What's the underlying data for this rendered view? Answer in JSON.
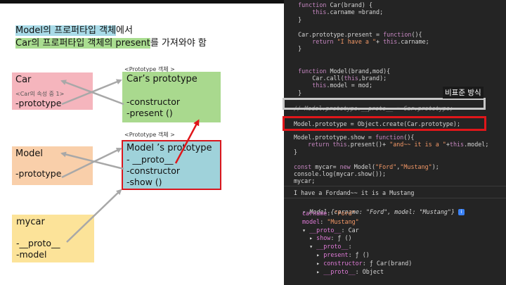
{
  "heading": {
    "line1_hl": "Model의 프로퍼타입 객체",
    "line1_rest": "에서",
    "line2_hl": "Car의 프로퍼타입 객체의 present",
    "line2_rest": "를 가져와야 함"
  },
  "diagram": {
    "car": {
      "title": "Car",
      "note": "<Car의 속성 중 1>",
      "prop": "-prototype"
    },
    "car_proto": {
      "caption": "<Prototype 객체 >",
      "title": "Car’s prototype",
      "lines": [
        "-constructor",
        "-present ()"
      ]
    },
    "model": {
      "title": "Model",
      "prop": "-prototype"
    },
    "model_proto": {
      "caption": "<Prototype 객체 >",
      "title": "Model ’s prototype",
      "lines": [
        "- __proto__",
        "-constructor",
        "-show ()"
      ]
    },
    "mycar": {
      "title": "mycar",
      "lines": [
        "-__proto__",
        "-model"
      ]
    }
  },
  "console": {
    "nonstandard_label": "비표준 방식",
    "code_lines": [
      "  function Car(brand) {",
      "      this.carname =brand;",
      "  }",
      "",
      "  Car.prototype.present = function(){",
      "      return \"I have a \"+ this.carname;",
      "  }",
      "",
      "",
      "  function Model(brand,mod){",
      "      Car.call(this,brand);",
      "      this.model = mod;",
      "  }"
    ],
    "comment_line": "// Model.prototype.__proto__ = Car.prototype;",
    "highlight_line": "Model.prototype = Object.create(Car.prototype);",
    "code_lines_2": [
      "Model.prototype.show = function(){",
      "    return this.present()+ \"and~~ it is a \"+this.model;",
      "}",
      "",
      "const mycar= new Model(\"Ford\",\"Mustang\");",
      "console.log(mycar.show());",
      "mycar;"
    ],
    "output": "I have a Fordand~~ it is a Mustang",
    "tree": {
      "root": "Model {carname: \"Ford\", model: \"Mustang\"}",
      "badge": "i",
      "lines": [
        "carname: \"Ford\"",
        "model: \"Mustang\"",
        "▾ __proto__: Car",
        "  ▸ show: ƒ ()",
        "  ▾ __proto__:",
        "    ▸ present: ƒ ()",
        "    ▸ constructor: ƒ Car(brand)",
        "    ▸ __proto__: Object"
      ]
    }
  }
}
